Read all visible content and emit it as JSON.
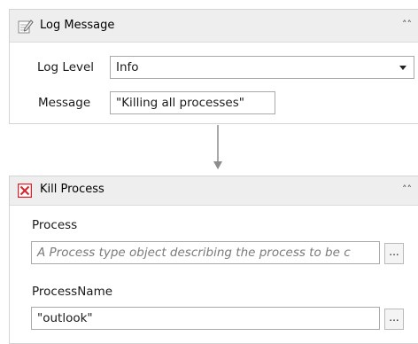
{
  "log_activity": {
    "title": "Log Message",
    "icon": "log-message-icon",
    "level_label": "Log Level",
    "level_value": "Info",
    "message_label": "Message",
    "message_value": "\"Killing all processes\""
  },
  "kill_activity": {
    "title": "Kill Process",
    "icon": "kill-process-icon",
    "process_label": "Process",
    "process_placeholder": "A Process type object describing the process to be c",
    "process_name_label": "ProcessName",
    "process_name_value": "\"outlook\"",
    "browse_label": "..."
  },
  "colors": {
    "header_bg": "#eeeeee",
    "border": "#d4d4d4",
    "kill_icon": "#d9242b",
    "connector": "#8c8c8c"
  }
}
